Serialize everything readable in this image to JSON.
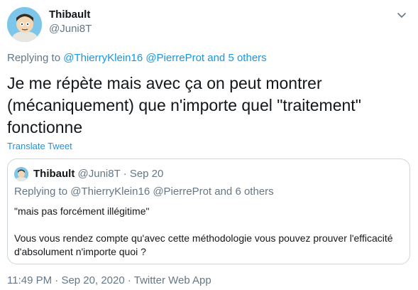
{
  "author": {
    "name": "Thibault",
    "handle": "@Juni8T"
  },
  "reply": {
    "prefix": "Replying to",
    "mention_1": "@ThierryKlein16",
    "mention_2": "@PierreProt",
    "conjunction": "and",
    "others": "5 others"
  },
  "tweet": {
    "text": "Je me répète mais avec ça on peut montrer (mécaniquement) que n'importe quel \"traitement\" fonctionne",
    "translate_label": "Translate Tweet"
  },
  "quoted": {
    "name": "Thibault",
    "handle": "@Juni8T",
    "separator": "·",
    "date": "Sep 20",
    "reply_prefix": "Replying to",
    "mention_1": "@ThierryKlein16",
    "mention_2": "@PierreProt",
    "conjunction": "and",
    "others": "6 others",
    "line_1": "\"mais pas forcément illégitime\"",
    "line_2": "Vous vous rendez compte qu'avec cette méthodologie vous pouvez prouver l'efficacité d'absolument n'importe quoi ?"
  },
  "footer": {
    "time": "11:49 PM",
    "separator": "·",
    "date": "Sep 20, 2020",
    "source": "Twitter Web App"
  },
  "icons": {
    "caret": "chevron-down-icon",
    "avatar": "avatar"
  },
  "colors": {
    "link": "#1b95e0",
    "secondary_text": "#657786",
    "primary_text": "#14171a",
    "border": "#ccd6dd"
  }
}
